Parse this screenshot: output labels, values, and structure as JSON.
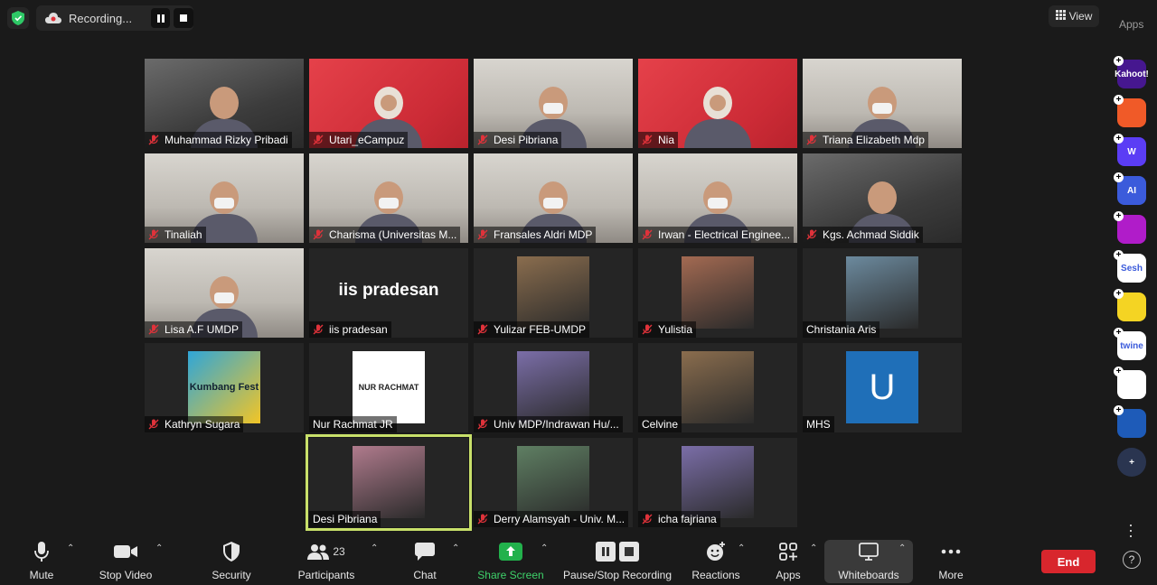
{
  "recording": {
    "label": "Recording..."
  },
  "view": {
    "label": "View"
  },
  "apps_panel": {
    "title": "Apps",
    "items": [
      {
        "name": "Kahoot!",
        "short": "Kahoot!",
        "color": "#46178f"
      },
      {
        "name": "Slido",
        "short": "",
        "color": "#f05a28"
      },
      {
        "name": "Wooclap",
        "short": "W",
        "color": "#5b3df5"
      },
      {
        "name": "AI app",
        "short": "AI",
        "color": "#3b5bdb"
      },
      {
        "name": "Connect app",
        "short": "",
        "color": "#b01cc9"
      },
      {
        "name": "Sesh",
        "short": "Sesh",
        "color": "#ffffff"
      },
      {
        "name": "Emoji app",
        "short": "",
        "color": "#f4d423"
      },
      {
        "name": "Twine",
        "short": "twine",
        "color": "#ffffff"
      },
      {
        "name": "Apps grid",
        "short": "",
        "color": "#ffffff"
      },
      {
        "name": "Sync app",
        "short": "",
        "color": "#1e5bb8"
      },
      {
        "name": "Add app",
        "short": "+",
        "color": "#2a3550"
      }
    ]
  },
  "participants": [
    {
      "name": "Muhammad Rizky Pribadi",
      "style": "video"
    },
    {
      "name": "Utari_eCampuz",
      "style": "red"
    },
    {
      "name": "Desi Pibriana",
      "style": "room"
    },
    {
      "name": "Nia",
      "style": "red"
    },
    {
      "name": "Triana Elizabeth Mdp",
      "style": "room"
    },
    {
      "name": "Tinaliah",
      "style": "room"
    },
    {
      "name": "Charisma (Universitas M...",
      "style": "room"
    },
    {
      "name": "Fransales Aldri MDP",
      "style": "room"
    },
    {
      "name": "Irwan - Electrical Enginee...",
      "style": "room"
    },
    {
      "name": "Kgs. Achmad Siddik",
      "style": "video"
    },
    {
      "name": "Lisa A.F UMDP",
      "style": "room"
    },
    {
      "name": "iis pradesan",
      "style": "dark",
      "display": "iis pradesan"
    },
    {
      "name": "Yulizar FEB-UMDP",
      "style": "dark"
    },
    {
      "name": "Yulistia",
      "style": "dark"
    },
    {
      "name": "Christania Aris",
      "style": "dark"
    },
    {
      "name": "Kathryn Sugara",
      "style": "dark",
      "pic_text": "Kumbang Fest"
    },
    {
      "name": "Nur Rachmat JR",
      "style": "dark",
      "pic_text": "NUR RACHMAT"
    },
    {
      "name": "Univ MDP/Indrawan Hu/...",
      "style": "dark"
    },
    {
      "name": "Celvine",
      "style": "dark"
    },
    {
      "name": "MHS",
      "style": "dark",
      "pic_text": "U"
    },
    {
      "name": "",
      "style": "empty"
    },
    {
      "name": "Desi Pibriana",
      "style": "dark",
      "active": true
    },
    {
      "name": "Derry Alamsyah - Univ. M...",
      "style": "dark"
    },
    {
      "name": "icha fajriana",
      "style": "dark"
    }
  ],
  "toolbar": {
    "mute": "Mute",
    "stop_video": "Stop Video",
    "security": "Security",
    "participants": "Participants",
    "participants_count": "23",
    "chat": "Chat",
    "share_screen": "Share Screen",
    "pause_stop": "Pause/Stop Recording",
    "reactions": "Reactions",
    "apps": "Apps",
    "whiteboards": "Whiteboards",
    "more": "More",
    "end": "End"
  },
  "colors": {
    "accent_green": "#3ed26a",
    "end_red": "#d8262d",
    "active_border": "#c8e06a"
  }
}
